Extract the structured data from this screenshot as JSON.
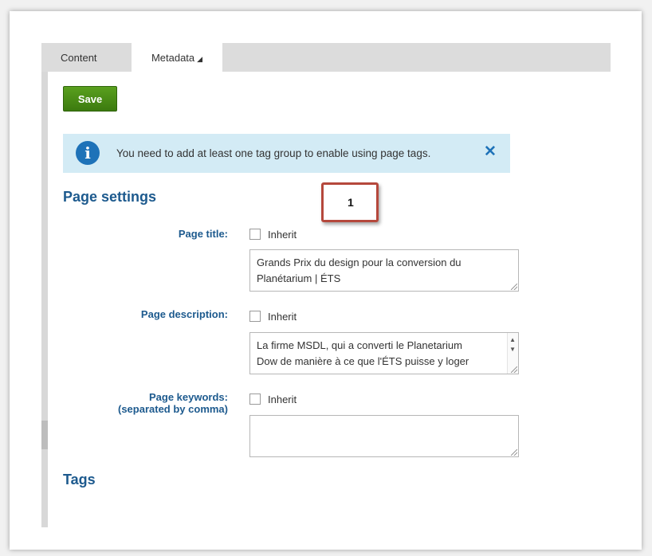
{
  "tabs": {
    "content_label": "Content",
    "metadata_label": "Metadata",
    "metadata_caret": "◢"
  },
  "toolbar": {
    "save_label": "Save"
  },
  "alert": {
    "icon": "i",
    "message": "You need to add at least one tag group to enable using page tags.",
    "close": "✕"
  },
  "page_settings": {
    "title": "Page settings",
    "callout": "1",
    "page_title": {
      "label": "Page title:",
      "inherit_label": "Inherit",
      "inherit_checked": false,
      "value_lines": [
        "Grands Prix du design pour la conversion du",
        "Planétarium | ÉTS"
      ]
    },
    "page_description": {
      "label": "Page description:",
      "inherit_label": "Inherit",
      "inherit_checked": false,
      "value_lines": [
        "La firme MSDL, qui a converti le Planetarium",
        "Dow de manière à ce que l'ÉTS puisse y loger"
      ]
    },
    "page_keywords": {
      "label_line1": "Page keywords:",
      "label_line2": "(separated by comma)",
      "inherit_label": "Inherit",
      "inherit_checked": false,
      "value": ""
    }
  },
  "tags": {
    "title": "Tags"
  },
  "colors": {
    "accent": "#1d5a8e",
    "save_button": "#4a8c16",
    "alert_bg": "#d3ebf5",
    "alert_icon": "#1e72b8",
    "callout_border": "#b5483c"
  }
}
